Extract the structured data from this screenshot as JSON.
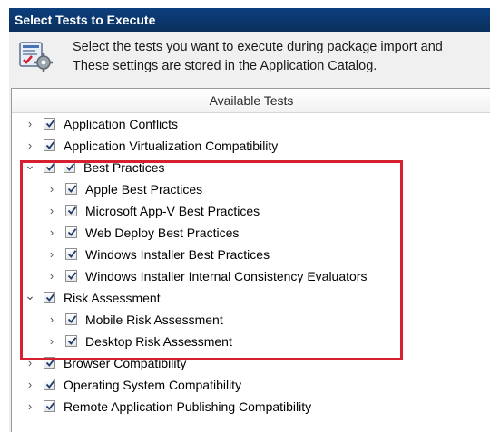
{
  "window": {
    "title": "Select Tests to Execute"
  },
  "header": {
    "icon": "test-settings-icon",
    "description_line1": "Select the tests you want to execute during package import and",
    "description_line2": "These settings are stored in the Application Catalog."
  },
  "tree": {
    "column_header": "Available Tests",
    "items": [
      {
        "label": "Application Conflicts",
        "level": 0,
        "expanded": false,
        "checked": true
      },
      {
        "label": "Application Virtualization Compatibility",
        "level": 0,
        "expanded": false,
        "checked": true
      },
      {
        "label": "Best Practices",
        "level": 0,
        "expanded": true,
        "checked": true
      },
      {
        "label": "Apple Best Practices",
        "level": 1,
        "expanded": false,
        "checked": true
      },
      {
        "label": "Microsoft App-V Best Practices",
        "level": 1,
        "expanded": false,
        "checked": true
      },
      {
        "label": "Web Deploy Best Practices",
        "level": 1,
        "expanded": false,
        "checked": true
      },
      {
        "label": "Windows Installer Best Practices",
        "level": 1,
        "expanded": false,
        "checked": true
      },
      {
        "label": "Windows Installer Internal Consistency Evaluators",
        "level": 1,
        "expanded": false,
        "checked": true
      },
      {
        "label": "Risk Assessment",
        "level": 0,
        "expanded": true,
        "checked": true
      },
      {
        "label": "Mobile Risk Assessment",
        "level": 1,
        "expanded": false,
        "checked": true
      },
      {
        "label": "Desktop Risk Assessment",
        "level": 1,
        "expanded": false,
        "checked": true
      },
      {
        "label": "Browser Compatibility",
        "level": 0,
        "expanded": false,
        "checked": true
      },
      {
        "label": "Operating System Compatibility",
        "level": 0,
        "expanded": false,
        "checked": true
      },
      {
        "label": "Remote Application Publishing Compatibility",
        "level": 0,
        "expanded": false,
        "checked": true
      }
    ]
  },
  "highlight": {
    "color": "#d62030"
  },
  "colors": {
    "title_bar": "#0c3f7e",
    "panel": "#f0f0f0"
  }
}
